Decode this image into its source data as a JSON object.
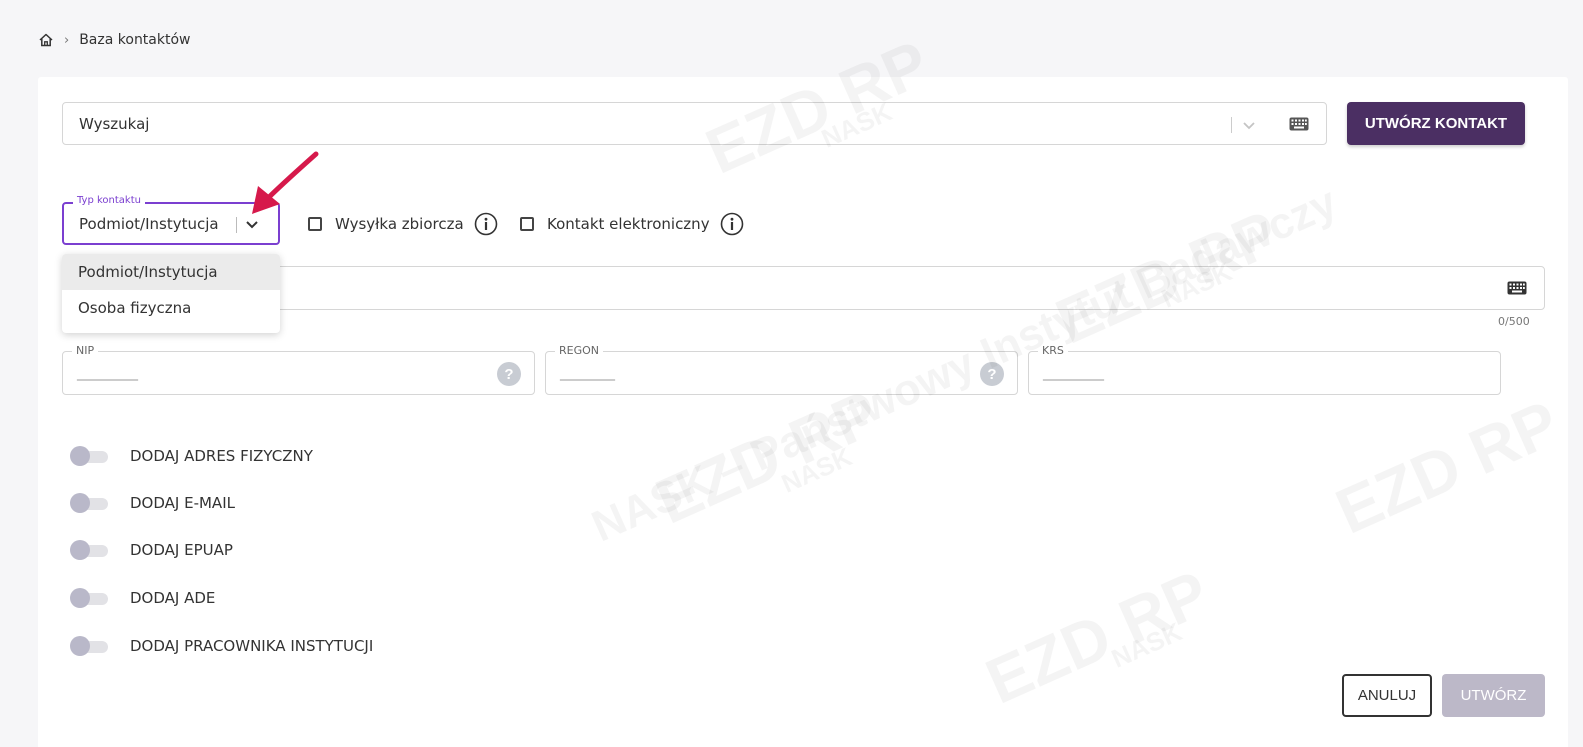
{
  "breadcrumb": {
    "home_icon": "home-icon",
    "current": "Baza kontaktów"
  },
  "search": {
    "placeholder": "Wyszukaj",
    "chevron_icon": "chevron-down-icon",
    "keyboard_icon": "keyboard-icon"
  },
  "header_actions": {
    "create_contact_label": "UTWÓRZ KONTAKT"
  },
  "contact_type": {
    "label": "Typ kontaktu",
    "value": "Podmiot/Instytucja",
    "options": [
      {
        "label": "Podmiot/Instytucja",
        "selected": true
      },
      {
        "label": "Osoba fizyczna",
        "selected": false
      }
    ]
  },
  "checkboxes": [
    {
      "label": "Wysyłka zbiorcza",
      "checked": false,
      "info_icon": "info-icon"
    },
    {
      "label": "Kontakt elektroniczny",
      "checked": false,
      "info_icon": "info-icon"
    }
  ],
  "name_field": {
    "counter": "0/500",
    "keyboard_icon": "keyboard-icon"
  },
  "id_fields": [
    {
      "label": "NIP",
      "mask": "__________",
      "help": "?"
    },
    {
      "label": "REGON",
      "mask": "_________",
      "help": "?"
    },
    {
      "label": "KRS",
      "mask": "__________"
    }
  ],
  "toggles": [
    {
      "label": "DODAJ ADRES FIZYCZNY",
      "on": false
    },
    {
      "label": "DODAJ E-MAIL",
      "on": false
    },
    {
      "label": "DODAJ EPUAP",
      "on": false
    },
    {
      "label": "DODAJ ADE",
      "on": false
    },
    {
      "label": "DODAJ PRACOWNIKA INSTYTUCJI",
      "on": false
    }
  ],
  "footer": {
    "cancel_label": "ANULUJ",
    "create_label": "UTWÓRZ"
  },
  "colors": {
    "primary": "#4b2f63",
    "focus": "#7b3fd0",
    "disabled": "#bcb8c8",
    "annotation_arrow": "#d6194b"
  },
  "watermark": {
    "lines": [
      "EZD RP",
      "NASK",
      "NASK – Państwowy Instytut Badawczy"
    ]
  }
}
